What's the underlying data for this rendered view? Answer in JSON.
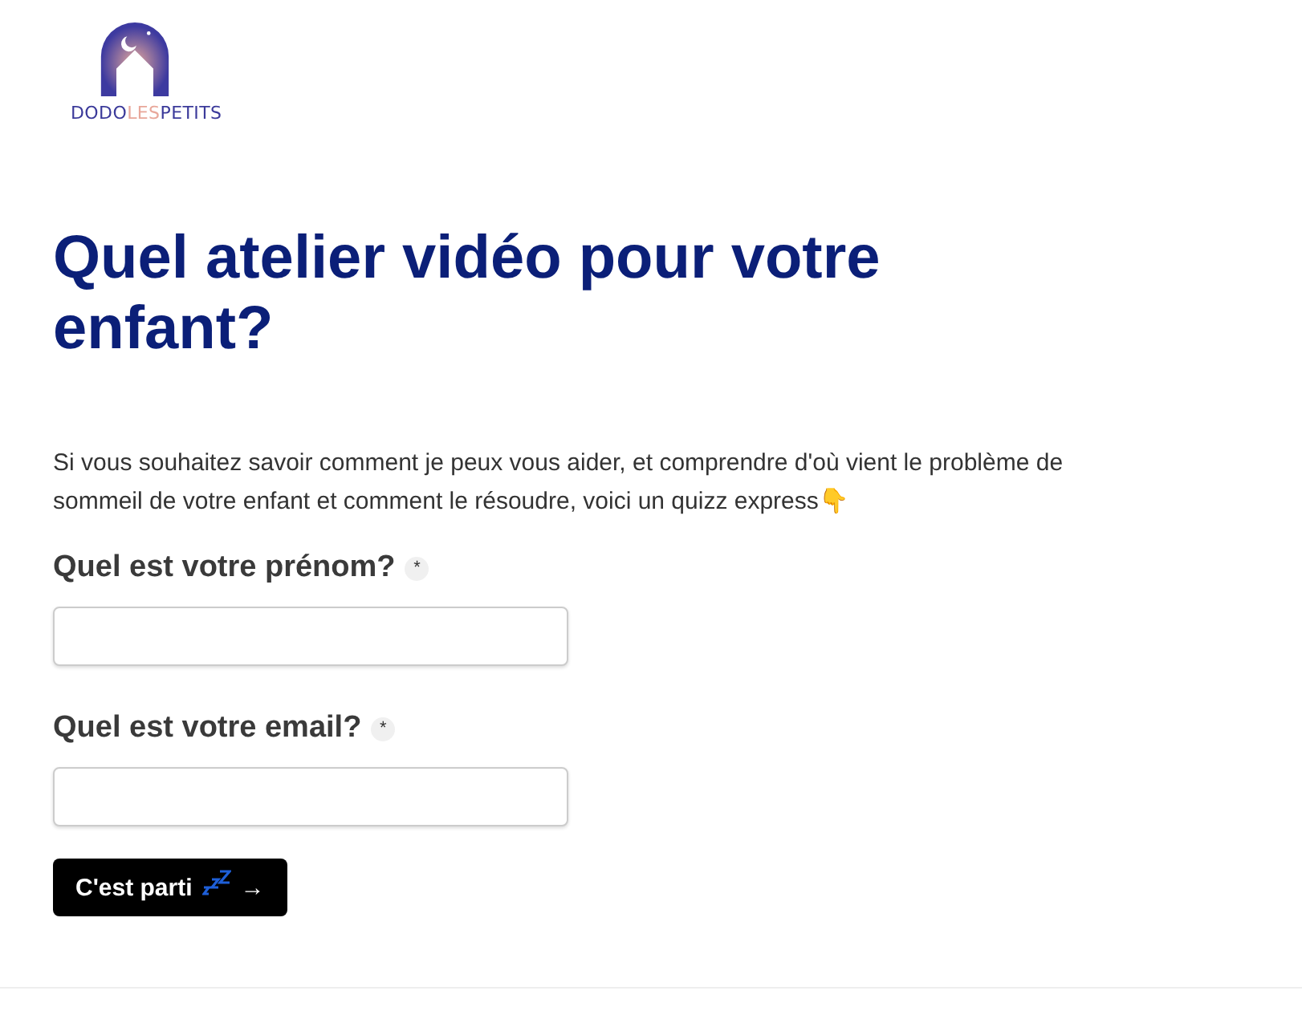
{
  "logo": {
    "parts": [
      {
        "text": "DODO",
        "color": "#3b3a9a"
      },
      {
        "text": "LES",
        "color": "#e8a79a"
      },
      {
        "text": "PETITS",
        "color": "#3b3a9a"
      }
    ]
  },
  "title": "Quel atelier vidéo pour votre enfant?",
  "intro": "Si vous souhaitez savoir comment je peux vous aider, et comprendre d'où vient le problème de sommeil de votre enfant et comment le résoudre, voici un quizz express👇",
  "fields": [
    {
      "label": "Quel est votre prénom?",
      "required_mark": "*"
    },
    {
      "label": "Quel est votre email?",
      "required_mark": "*"
    }
  ],
  "submit": {
    "label": "C'est parti",
    "arrow": "→"
  }
}
